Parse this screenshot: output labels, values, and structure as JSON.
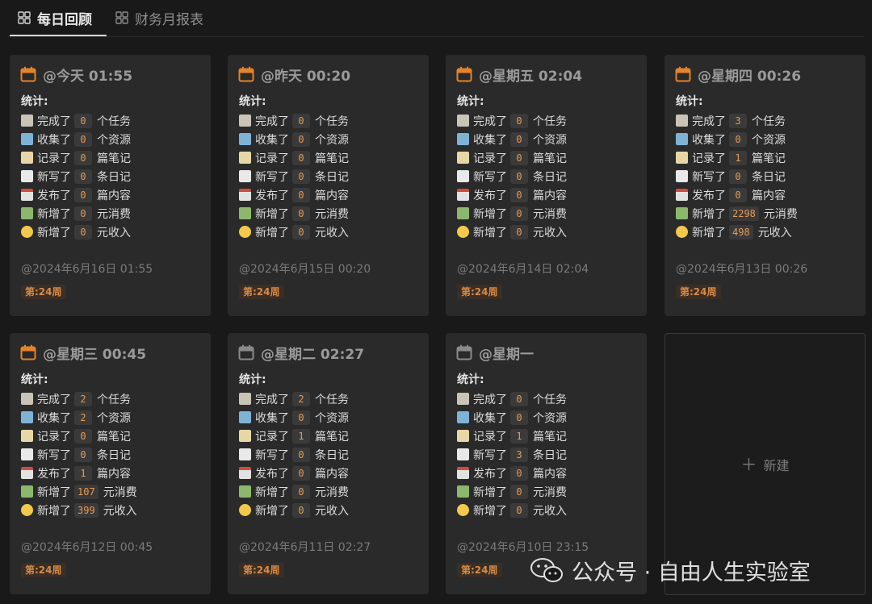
{
  "tabs": [
    {
      "label": "每日回顾",
      "active": true,
      "icon": "grid-icon"
    },
    {
      "label": "财务月报表",
      "active": false,
      "icon": "grid-icon"
    }
  ],
  "stats_label": "统计:",
  "line_templates": [
    {
      "icon": "clipboard-icon",
      "prefix": "完成了",
      "suffix": "个任务"
    },
    {
      "icon": "package-icon",
      "prefix": "收集了",
      "suffix": "个资源"
    },
    {
      "icon": "memo-icon",
      "prefix": "记录了",
      "suffix": "篇笔记"
    },
    {
      "icon": "notepad-icon",
      "prefix": "新写了",
      "suffix": "条日记"
    },
    {
      "icon": "calendar-icon",
      "prefix": "发布了",
      "suffix": "篇内容"
    },
    {
      "icon": "money-icon",
      "prefix": "新增了",
      "suffix": "元消费"
    },
    {
      "icon": "money-face-icon",
      "prefix": "新增了",
      "suffix": "元收入"
    }
  ],
  "cards": [
    {
      "title": "@今天 01:55",
      "values": [
        "0",
        "0",
        "0",
        "0",
        "0",
        "0",
        "0"
      ],
      "date": "@2024年6月16日 01:55",
      "week": "第:24周",
      "icon_color": "#e5832b"
    },
    {
      "title": "@昨天 00:20",
      "values": [
        "0",
        "0",
        "0",
        "0",
        "0",
        "0",
        "0"
      ],
      "date": "@2024年6月15日 00:20",
      "week": "第:24周",
      "icon_color": "#e5832b"
    },
    {
      "title": "@星期五 02:04",
      "values": [
        "0",
        "0",
        "0",
        "0",
        "0",
        "0",
        "0"
      ],
      "date": "@2024年6月14日 02:04",
      "week": "第:24周",
      "icon_color": "#e5832b"
    },
    {
      "title": "@星期四 00:26",
      "values": [
        "3",
        "0",
        "1",
        "0",
        "0",
        "2298",
        "498"
      ],
      "date": "@2024年6月13日 00:26",
      "week": "第:24周",
      "icon_color": "#e5832b"
    },
    {
      "title": "@星期三 00:45",
      "values": [
        "2",
        "2",
        "0",
        "0",
        "1",
        "107",
        "399"
      ],
      "date": "@2024年6月12日 00:45",
      "week": "第:24周",
      "icon_color": "#e5832b"
    },
    {
      "title": "@星期二 02:27",
      "values": [
        "2",
        "0",
        "1",
        "0",
        "0",
        "0",
        "0"
      ],
      "date": "@2024年6月11日 02:27",
      "week": "第:24周",
      "icon_color": "#8a8a8a"
    },
    {
      "title": "@星期一",
      "values": [
        "0",
        "0",
        "1",
        "3",
        "0",
        "0",
        "0"
      ],
      "date": "@2024年6月10日 23:15",
      "week": "第:24周",
      "icon_color": "#8a8a8a"
    }
  ],
  "new_button": {
    "icon": "plus-icon",
    "label": "新建"
  },
  "watermark": {
    "icon": "wechat-icon",
    "text": "公众号 · 自由人生实验室"
  }
}
